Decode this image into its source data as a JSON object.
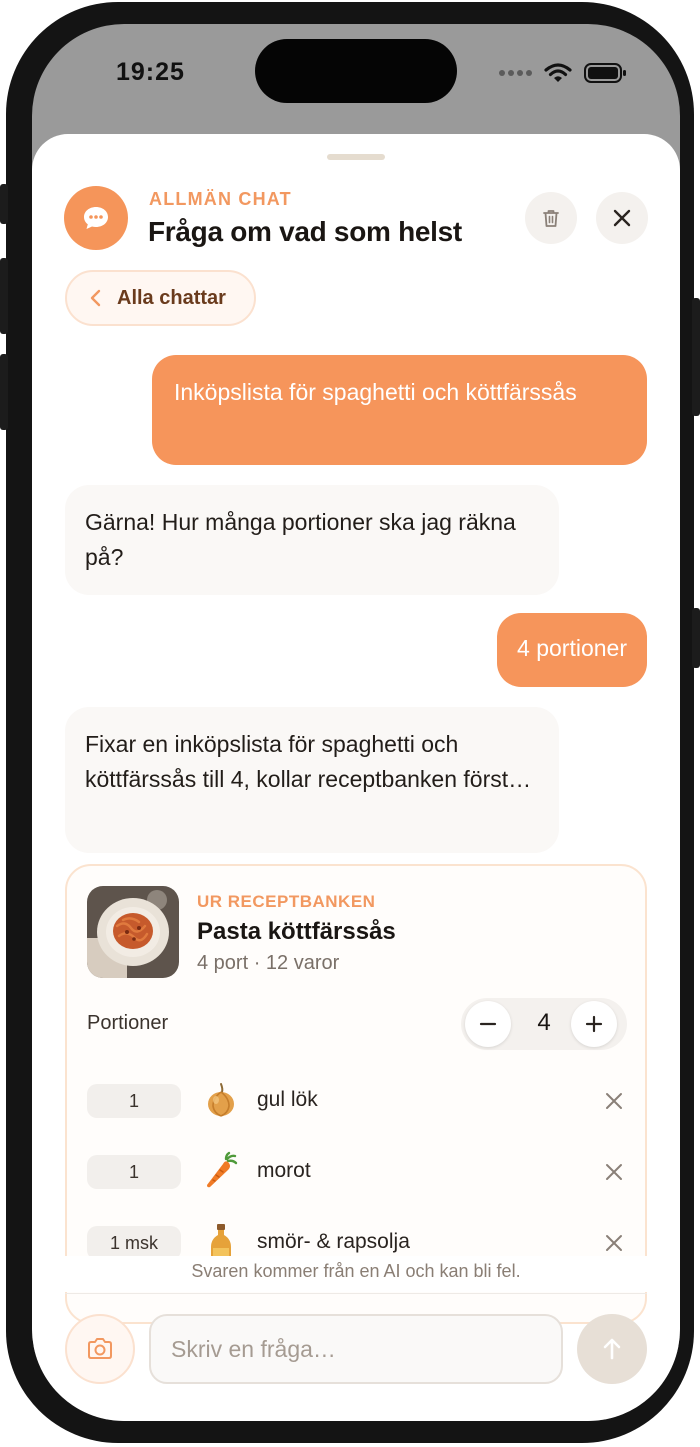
{
  "status_bar": {
    "time": "19:25"
  },
  "header": {
    "eyebrow": "ALLMÄN CHAT",
    "title": "Fråga om vad som helst",
    "avatar_icon": "chat-bubble-icon",
    "delete_icon": "trash-icon",
    "close_icon": "close-icon"
  },
  "back_chip": {
    "label": "Alla chattar",
    "icon": "chevron-left-icon"
  },
  "messages": [
    {
      "role": "user",
      "text": "Inköpslista för spaghetti och köttfärssås"
    },
    {
      "role": "assistant",
      "text": "Gärna! Hur många portioner ska jag räkna på?"
    },
    {
      "role": "user",
      "text": "4 portioner"
    },
    {
      "role": "assistant",
      "text": "Fixar en inköpslista för spaghetti och köttfärssås till 4, kollar receptbanken först…"
    }
  ],
  "recipe_card": {
    "eyebrow": "UR RECEPTBANKEN",
    "title": "Pasta köttfärssås",
    "meta": "4 port · 12 varor",
    "portions_label": "Portioner",
    "portions_value": "4",
    "ingredients": [
      {
        "qty": "1",
        "icon": "onion-icon",
        "name": "gul lök"
      },
      {
        "qty": "1",
        "icon": "carrot-icon",
        "name": "morot"
      },
      {
        "qty": "1 msk",
        "icon": "oil-bottle-icon",
        "name": "smör- & rapsolja"
      }
    ]
  },
  "disclaimer": "Svaren kommer från en AI och kan bli fel.",
  "composer": {
    "placeholder": "Skriv en fråga…",
    "camera_icon": "camera-icon",
    "send_icon": "arrow-up-icon"
  },
  "colors": {
    "accent": "#f6955b",
    "accent_text": "#f29860",
    "assistant_bubble": "#faf8f6",
    "card_border": "#fbe3cf"
  }
}
